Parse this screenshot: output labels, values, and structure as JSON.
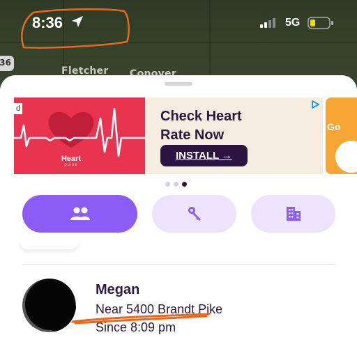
{
  "status_bar": {
    "time": "8:36",
    "network": "5G",
    "location_icon": "navigation-arrow-icon",
    "battery_icon": "battery-low-icon",
    "signal_icon": "cell-signal-icon"
  },
  "map": {
    "labels": [
      "Fletcher",
      "Conover"
    ],
    "route_shield": "36"
  },
  "ad": {
    "badge": "d",
    "brand_name": "Heart",
    "brand_sub": "pulse",
    "headline": "Check Heart Rate Now",
    "cta": "INSTALL →",
    "choices_icon": "ad-choices-icon",
    "next_ad_text": "Go",
    "accent_color": "#e8344f"
  },
  "carousel": {
    "pages": 3,
    "active_page": 3
  },
  "tabs": [
    {
      "id": "people",
      "icon": "people-icon",
      "active": true
    },
    {
      "id": "items",
      "icon": "keys-icon",
      "active": false
    },
    {
      "id": "places",
      "icon": "building-icon",
      "active": false
    }
  ],
  "member": {
    "name": "Megan",
    "location": "Near 5400 Brandt Pike",
    "since": "Since 8:09 pm"
  },
  "colors": {
    "accent": "#8b5cf6",
    "tab_inactive": "#ece4fb",
    "text_primary": "#2b1a3d",
    "annotation": "#e8681c"
  }
}
